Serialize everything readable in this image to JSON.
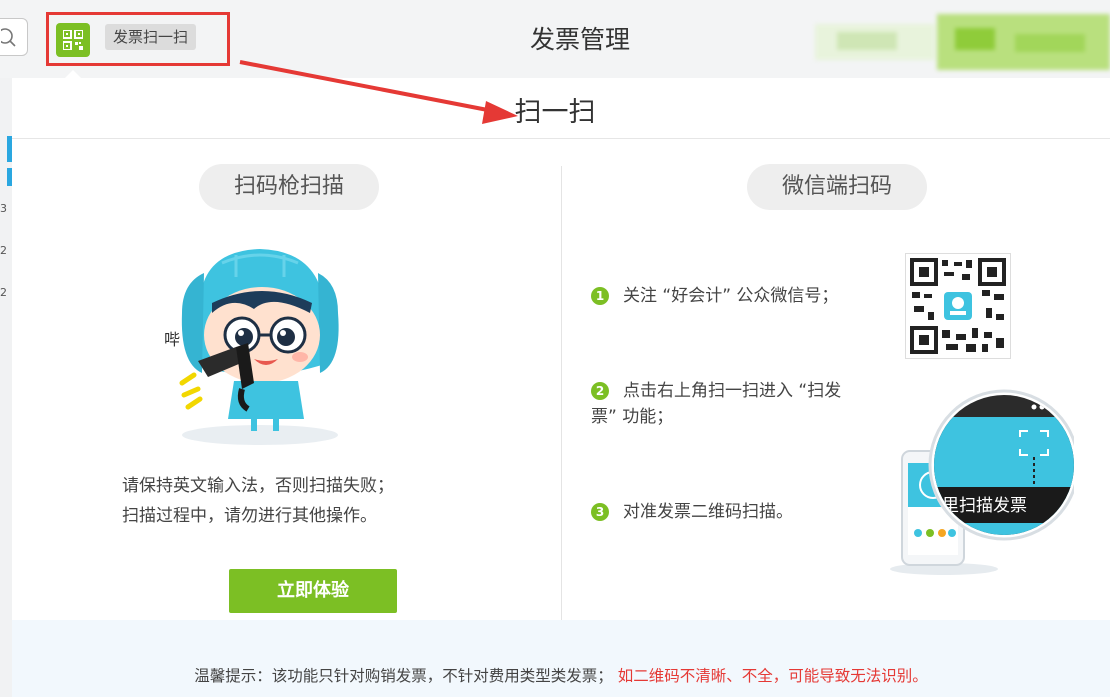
{
  "header": {
    "scan_shortcut_label": "发票扫一扫",
    "title": "发票管理"
  },
  "panel": {
    "title": "扫一扫",
    "left": {
      "heading": "扫码枪扫描",
      "mascot_word": "哔",
      "instruction_line1": "请保持英文输入法，否则扫描失败；",
      "instruction_line2": "扫描过程中，请勿进行其他操作。",
      "try_button": "立即体验"
    },
    "right": {
      "heading": "微信端扫码",
      "steps": [
        {
          "num": "1",
          "text": "关注 “好会计” 公众微信号；"
        },
        {
          "num": "2",
          "text_line1": "点击右上角扫一扫进入 “扫发",
          "text_line2": "票” 功能；"
        },
        {
          "num": "3",
          "text": "对准发票二维码扫描。"
        }
      ],
      "phone_caption": "里扫描发票"
    }
  },
  "tip": {
    "normal": "温馨提示：该功能只针对购销发票，不针对费用类型类发票；",
    "warning": "如二维码不清晰、不全，可能导致无法识别。"
  },
  "sidebar_numbers": [
    "3",
    "2",
    "2"
  ],
  "colors": {
    "accent_green": "#7cbf24",
    "annotation_red": "#e53935",
    "mascot_blue": "#3ec3e0",
    "tip_background": "#f2f8fd"
  },
  "icons": [
    "search-icon",
    "qr-scan-icon",
    "qr-code-image"
  ]
}
